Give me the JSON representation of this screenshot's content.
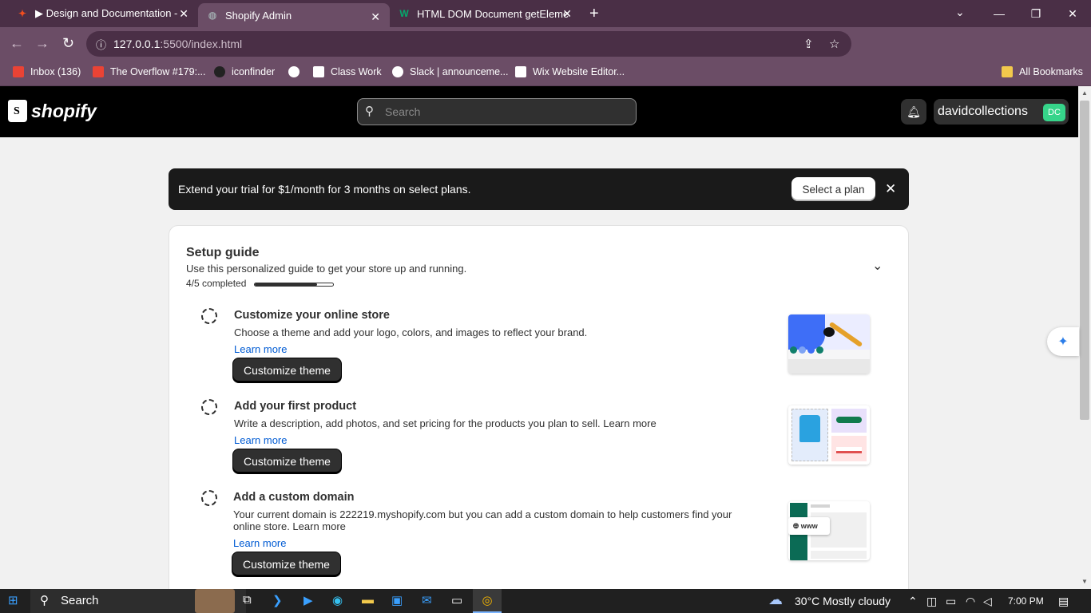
{
  "browser": {
    "tabs": [
      {
        "title": "▶ Design and Documentation -",
        "icon": "figma-icon",
        "color": "#f24e1e"
      },
      {
        "title": "Shopify Admin",
        "icon": "globe-icon",
        "color": "#9aa0a6"
      },
      {
        "title": "HTML DOM Document getEleme",
        "icon": "w3schools-icon",
        "color": "#04aa6d"
      }
    ],
    "url_host": "127.0.0.1",
    "url_path": ":5500/index.html",
    "bookmarks": [
      {
        "label": "Inbox (136)",
        "color": "#ea4335"
      },
      {
        "label": "The Overflow #179:...",
        "color": "#ea4335"
      },
      {
        "label": "iconfinder",
        "color": "#222"
      },
      {
        "label": "",
        "color": "#ffffff"
      },
      {
        "label": "Class Work",
        "color": "#ffffff"
      },
      {
        "label": "Slack | announceme...",
        "color": "#ffffff"
      },
      {
        "label": "Wix Website Editor...",
        "color": "#ffffff"
      }
    ],
    "all_bookmarks": "All Bookmarks"
  },
  "header": {
    "logo": "shopify",
    "search_placeholder": "Search",
    "store_name": "davidcollections",
    "avatar_initials": "DC"
  },
  "banner": {
    "text": "Extend your trial for $1/month for 3 months on select plans.",
    "button": "Select a plan"
  },
  "setup": {
    "title": "Setup guide",
    "subtitle": "Use this personalized guide to get your store up and running.",
    "progress_text": "4/5 completed",
    "progress_fraction": 0.8,
    "tasks": [
      {
        "title": "Customize your online store",
        "description": "Choose a theme and add your logo, colors, and images to reflect your brand.",
        "link": "Learn more",
        "button": "Customize theme"
      },
      {
        "title": "Add your first product",
        "description": "Write a description, add photos, and set pricing for the products you plan to sell. Learn more",
        "link": "Learn more",
        "button": "Customize theme"
      },
      {
        "title": "Add a custom domain",
        "description": "Your current domain is 222219.myshopify.com but you can add a custom domain to help customers find your online store. Learn more",
        "link": "Learn more",
        "button": "Customize theme"
      }
    ],
    "domain_illustration_text": "www"
  },
  "taskbar": {
    "search": "Search",
    "weather": "30°C  Mostly cloudy",
    "time": "7:00 PM"
  }
}
